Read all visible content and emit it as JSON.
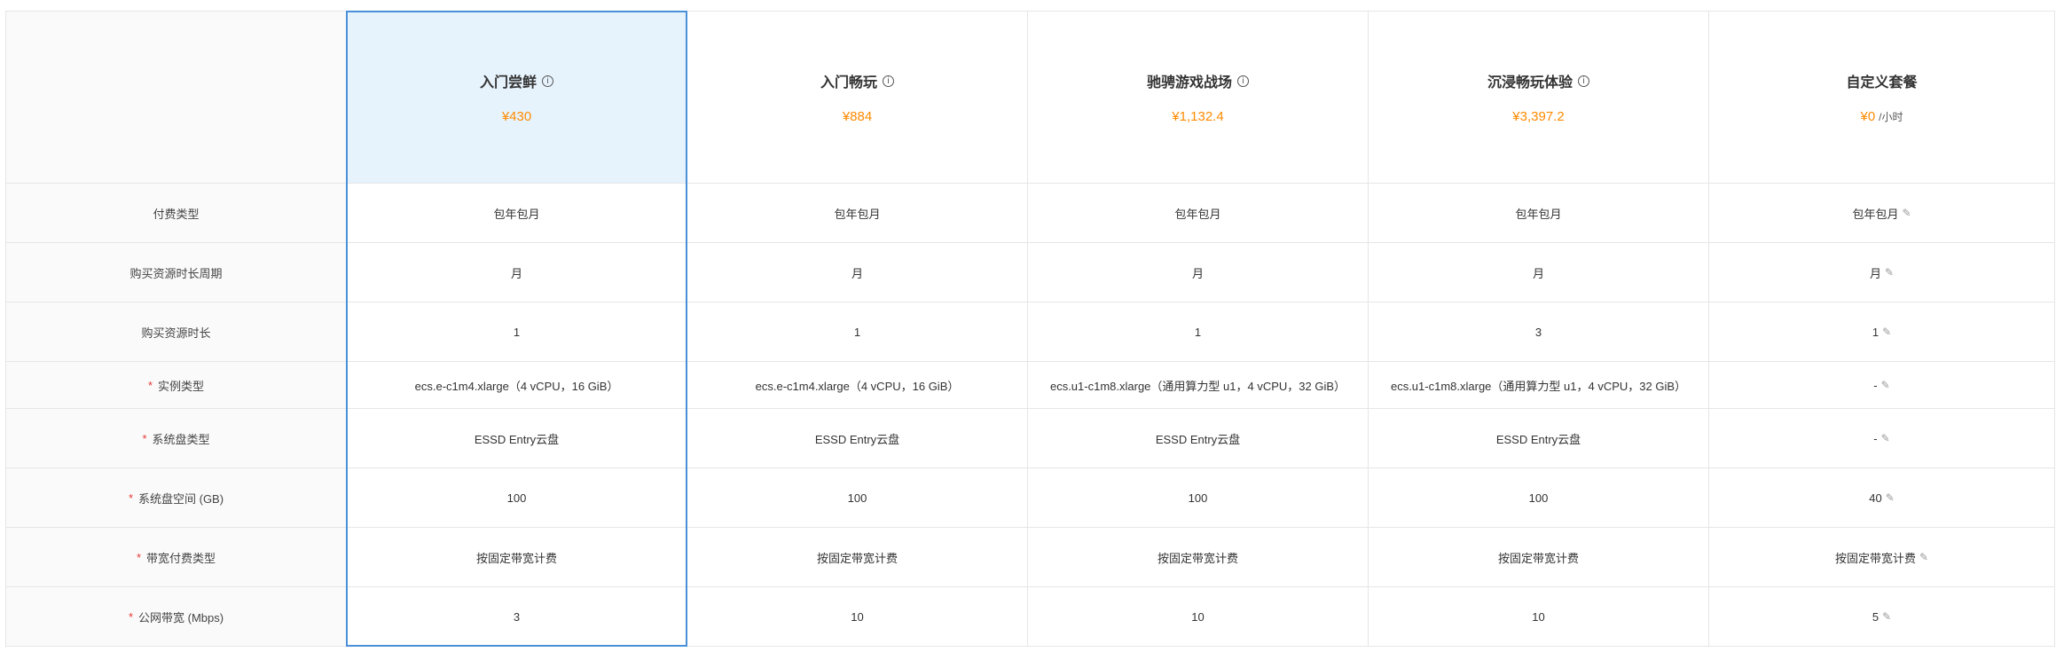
{
  "plans": [
    {
      "name": "入门尝鲜",
      "price": "¥430",
      "has_info": true
    },
    {
      "name": "入门畅玩",
      "price": "¥884",
      "has_info": true
    },
    {
      "name": "驰骋游戏战场",
      "price": "¥1,132.4",
      "has_info": true
    },
    {
      "name": "沉浸畅玩体验",
      "price": "¥3,397.2",
      "has_info": true
    },
    {
      "name": "自定义套餐",
      "price": "¥0",
      "unit": "/小时",
      "has_info": false
    }
  ],
  "rows": [
    {
      "label": "付费类型",
      "required": false,
      "values": [
        "包年包月",
        "包年包月",
        "包年包月",
        "包年包月",
        "包年包月"
      ]
    },
    {
      "label": "购买资源时长周期",
      "required": false,
      "values": [
        "月",
        "月",
        "月",
        "月",
        "月"
      ]
    },
    {
      "label": "购买资源时长",
      "required": false,
      "values": [
        "1",
        "1",
        "1",
        "3",
        "1"
      ]
    },
    {
      "label": "实例类型",
      "required": true,
      "values": [
        "ecs.e-c1m4.xlarge（4 vCPU，16 GiB）",
        "ecs.e-c1m4.xlarge（4 vCPU，16 GiB）",
        "ecs.u1-c1m8.xlarge（通用算力型 u1，4 vCPU，32 GiB）",
        "ecs.u1-c1m8.xlarge（通用算力型 u1，4 vCPU，32 GiB）",
        "-"
      ]
    },
    {
      "label": "系统盘类型",
      "required": true,
      "values": [
        "ESSD Entry云盘",
        "ESSD Entry云盘",
        "ESSD Entry云盘",
        "ESSD Entry云盘",
        "-"
      ]
    },
    {
      "label": "系统盘空间 (GB)",
      "required": true,
      "values": [
        "100",
        "100",
        "100",
        "100",
        "40"
      ]
    },
    {
      "label": "带宽付费类型",
      "required": true,
      "values": [
        "按固定带宽计费",
        "按固定带宽计费",
        "按固定带宽计费",
        "按固定带宽计费",
        "按固定带宽计费"
      ]
    },
    {
      "label": "公网带宽 (Mbps)",
      "required": true,
      "values": [
        "3",
        "10",
        "10",
        "10",
        "5"
      ]
    }
  ],
  "icons": {
    "info": "info-icon",
    "edit": "edit-pencil-icon"
  },
  "colors": {
    "price": "#ff8a00",
    "selected_border": "#4a90d9",
    "selected_bg": "#e6f3fd",
    "required": "#e53935"
  }
}
